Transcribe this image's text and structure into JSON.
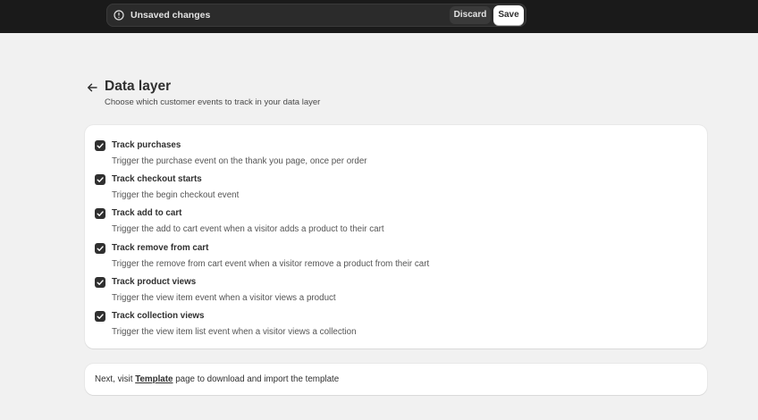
{
  "save_bar": {
    "message": "Unsaved changes",
    "discard_label": "Discard",
    "save_label": "Save",
    "icon": "alert-circle-icon"
  },
  "page": {
    "back_icon": "arrow-left-icon",
    "title": "Data layer",
    "subtitle": "Choose which customer events to track in your data layer"
  },
  "options": [
    {
      "label": "Track purchases",
      "description": "Trigger the purchase event on the thank you page, once per order",
      "checked": true
    },
    {
      "label": "Track checkout starts",
      "description": "Trigger the begin checkout event",
      "checked": true
    },
    {
      "label": "Track add to cart",
      "description": "Trigger the add to cart event when a visitor adds a product to their cart",
      "checked": true
    },
    {
      "label": "Track remove from cart",
      "description": "Trigger the remove from cart event when a visitor remove a product from their cart",
      "checked": true
    },
    {
      "label": "Track product views",
      "description": "Trigger the view item event when a visitor views a product",
      "checked": true
    },
    {
      "label": "Track collection views",
      "description": "Trigger the view item list event when a visitor views a collection",
      "checked": true
    }
  ],
  "next": {
    "prefix": "Next, visit ",
    "link": "Template",
    "suffix": " page to download and import the template"
  },
  "colors": {
    "topbar": "#1a1a1a",
    "background": "#f1f1f1",
    "checkbox": "#303030"
  }
}
